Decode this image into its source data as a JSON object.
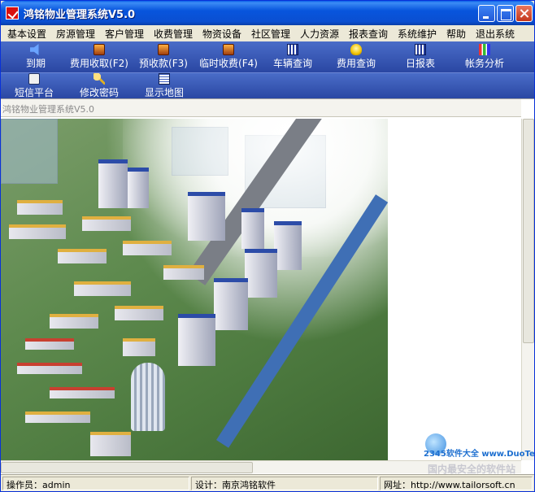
{
  "window": {
    "title": "鸿铭物业管理系统V5.0"
  },
  "menu": [
    "基本设置",
    "房源管理",
    "客户管理",
    "收费管理",
    "物资设备",
    "社区管理",
    "人力资源",
    "报表查询",
    "系统维护",
    "帮助",
    "退出系统"
  ],
  "toolbar1": [
    {
      "label": "到期",
      "icon": "speaker-icon"
    },
    {
      "label": "费用收取(F2)",
      "icon": "box-icon"
    },
    {
      "label": "预收款(F3)",
      "icon": "box-icon"
    },
    {
      "label": "临时收费(F4)",
      "icon": "box-icon"
    },
    {
      "label": "车辆查询",
      "icon": "calendar-icon"
    },
    {
      "label": "费用查询",
      "icon": "bulb-icon"
    },
    {
      "label": "日报表",
      "icon": "calendar-icon"
    },
    {
      "label": "帐务分析",
      "icon": "bar-chart-icon"
    }
  ],
  "toolbar2": [
    {
      "label": "短信平台",
      "icon": "phone-icon"
    },
    {
      "label": "修改密码",
      "icon": "key-icon"
    },
    {
      "label": "显示地图",
      "icon": "grid-icon"
    }
  ],
  "child": {
    "title": "鸿铭物业管理系统V5.0"
  },
  "watermark": {
    "line1": "2345软件大全",
    "line2": "www.DuoTe.com",
    "line3": "国内最安全的软件站"
  },
  "status": {
    "operator": "操作员：admin",
    "design": "设计：南京鸿铭软件",
    "website": "网址：http://www.tailorsoft.cn"
  }
}
